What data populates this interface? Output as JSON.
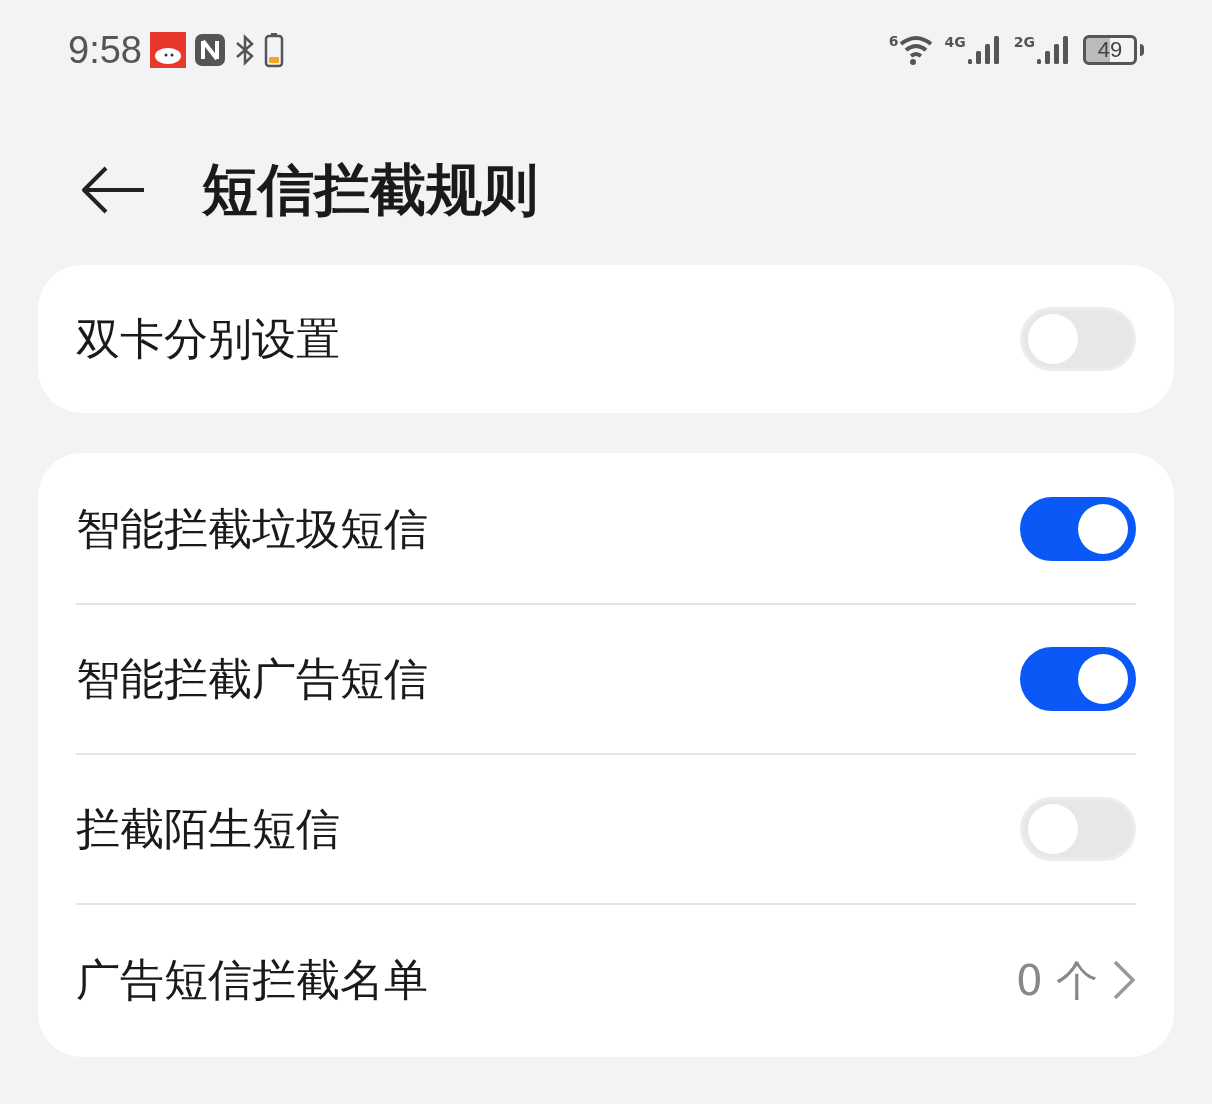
{
  "status_bar": {
    "time": "9:58",
    "wifi_badge": "6",
    "networks": [
      {
        "label": "4G"
      },
      {
        "label": "2G"
      }
    ],
    "battery": "49"
  },
  "header": {
    "title": "短信拦截规则"
  },
  "groups": [
    {
      "items": [
        {
          "kind": "toggle",
          "label": "双卡分别设置",
          "on": false
        }
      ]
    },
    {
      "items": [
        {
          "kind": "toggle",
          "label": "智能拦截垃圾短信",
          "on": true
        },
        {
          "kind": "toggle",
          "label": "智能拦截广告短信",
          "on": true
        },
        {
          "kind": "toggle",
          "label": "拦截陌生短信",
          "on": false
        },
        {
          "kind": "link",
          "label": "广告短信拦截名单",
          "value": "0 个"
        }
      ]
    }
  ]
}
